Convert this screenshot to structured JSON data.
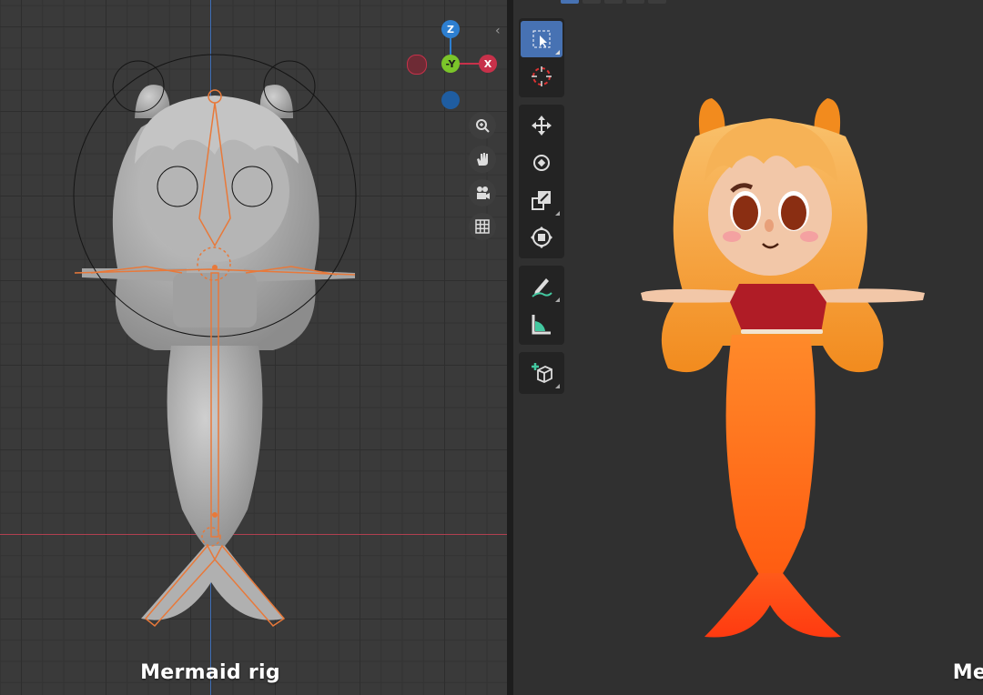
{
  "left_viewport": {
    "caption": "Mermaid rig",
    "gizmo": {
      "z_label": "Z",
      "y_label": "-Y",
      "x_label": "X"
    },
    "nav_buttons": [
      "zoom-icon",
      "hand-pan-icon",
      "camera-icon",
      "grid-icon"
    ]
  },
  "right_viewport": {
    "caption": "Mermaid model",
    "toolbar_tools": [
      "select-box-icon",
      "cursor-icon",
      "move-icon",
      "rotate-icon",
      "scale-icon",
      "transform-icon",
      "annotate-icon",
      "measure-icon",
      "add-cube-icon"
    ]
  },
  "colors": {
    "accent": "#4772b3",
    "axis_x": "#c7314a",
    "axis_y": "#7bc52a",
    "axis_z": "#2d7fd1",
    "bone": "#e8793a",
    "mermaid_hair": "#f4a640",
    "mermaid_tail": "#ff6a1a",
    "shirt": "#b01c26"
  }
}
